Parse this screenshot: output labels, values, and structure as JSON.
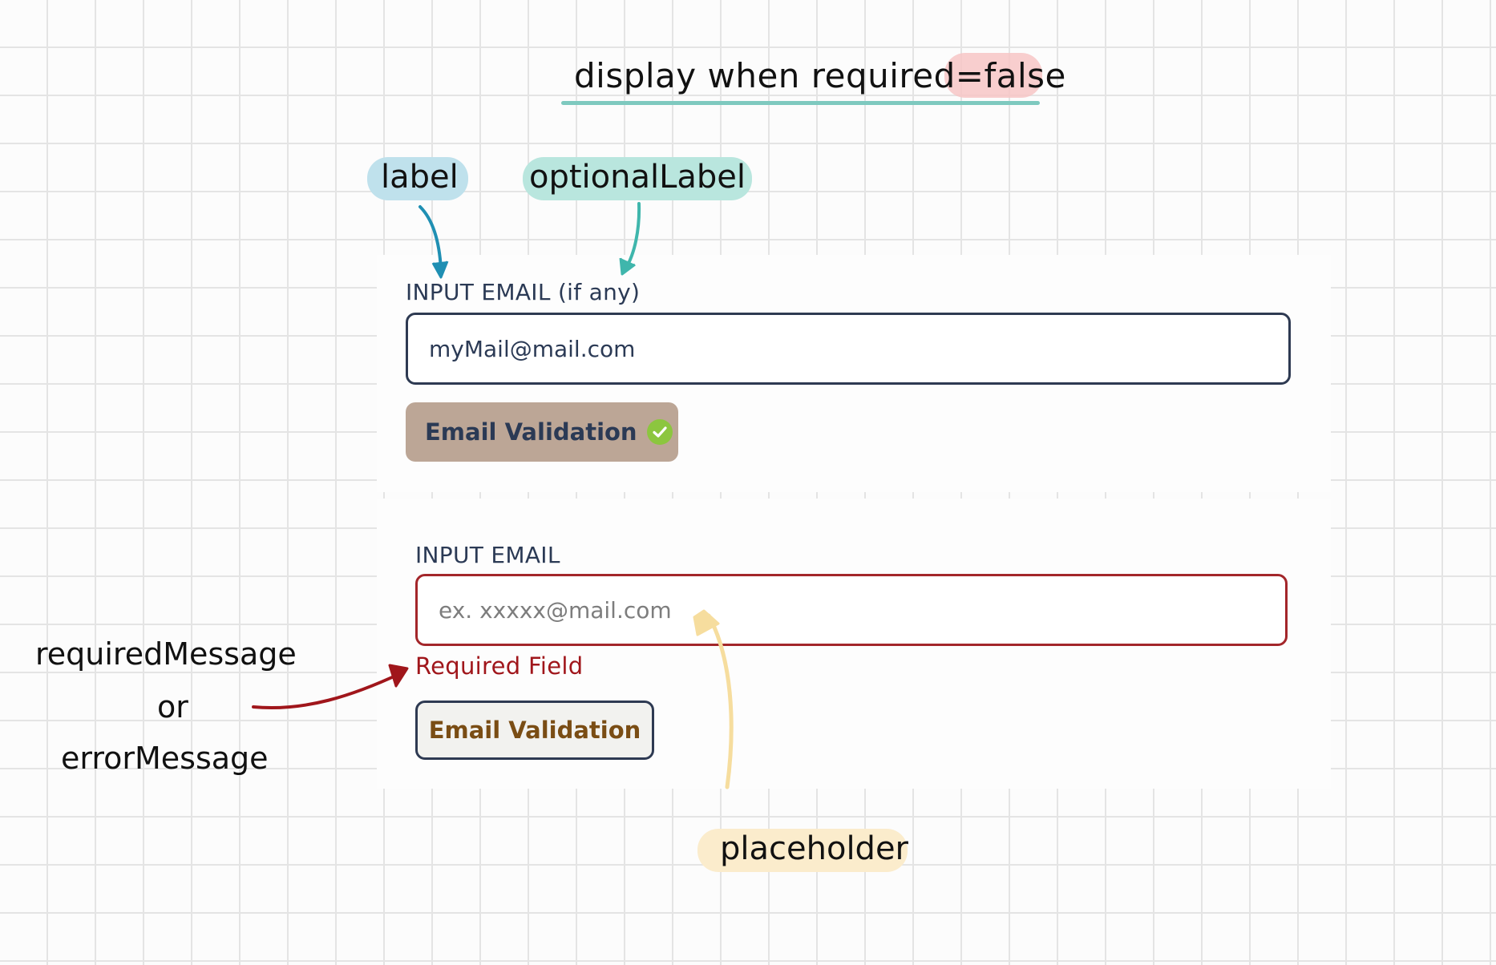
{
  "title": {
    "prefix": "display when required=",
    "highlight": "false"
  },
  "annotations": {
    "label": "label",
    "optional_label": "optionalLabel",
    "placeholder": "placeholder",
    "required_message": "requiredMessage",
    "or": "or",
    "error_message": "errorMessage"
  },
  "form_optional": {
    "label": "INPUT EMAIL",
    "optional_label": "(if any)",
    "input_value": "myMail@mail.com",
    "button_label": "Email Validation",
    "button_icon": "check-circle-icon"
  },
  "form_required": {
    "label": "INPUT EMAIL",
    "placeholder": "ex. xxxxx@mail.com",
    "required_message": "Required Field",
    "button_label": "Email Validation"
  },
  "colors": {
    "label_arrow": "#1f8fb3",
    "optional_arrow": "#3fb6ac",
    "error_arrow": "#a0161b",
    "placeholder_arrow": "#f6dd9e",
    "error": "#a0161b",
    "success_check": "#8cc63f",
    "validated_button_bg": "#bca696"
  }
}
